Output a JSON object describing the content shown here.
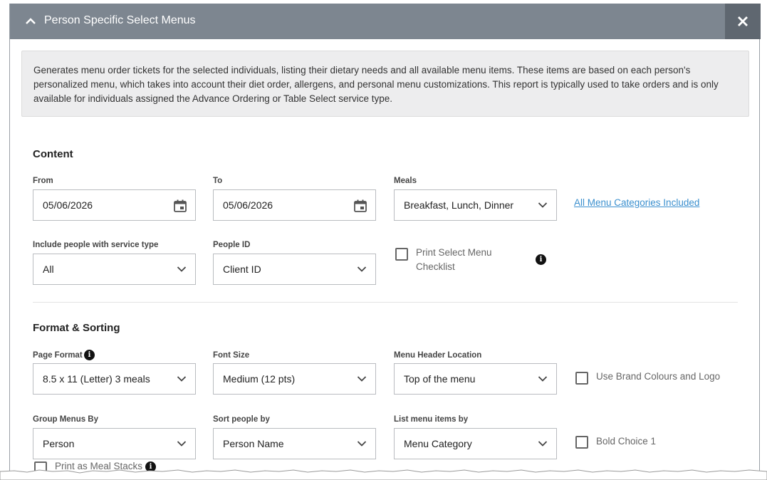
{
  "header": {
    "title": "Person Specific Select Menus",
    "collapse_icon": "chevron-up-icon",
    "close_icon": "close-icon"
  },
  "description": "Generates menu order tickets for the selected individuals, listing their dietary needs and all available menu items. These items are based on each person's personalized menu, which takes into account their diet order, allergens, and personal menu customizations. This report is typically used to take orders and is only available for individuals assigned the Advance Ordering or Table Select service type.",
  "content": {
    "title": "Content",
    "from": {
      "label": "From",
      "value": "05/06/2026"
    },
    "to": {
      "label": "To",
      "value": "05/06/2026"
    },
    "meals": {
      "label": "Meals",
      "value": "Breakfast, Lunch, Dinner"
    },
    "categories_link": "All Menu Categories Included",
    "service_type": {
      "label": "Include people with service type",
      "value": "All"
    },
    "people_id": {
      "label": "People ID",
      "value": "Client ID"
    },
    "print_checklist": {
      "line1": "Print Select Menu",
      "line2": "Checklist",
      "checked": false
    }
  },
  "format": {
    "title": "Format & Sorting",
    "page_format": {
      "label": "Page Format",
      "value": "8.5 x 11 (Letter) 3 meals"
    },
    "font_size": {
      "label": "Font Size",
      "value": "Medium (12 pts)"
    },
    "menu_header": {
      "label": "Menu Header Location",
      "value": "Top of the menu"
    },
    "brand": {
      "label": "Use Brand Colours and Logo",
      "checked": false
    },
    "group_by": {
      "label": "Group Menus By",
      "value": "Person"
    },
    "sort_by": {
      "label": "Sort people by",
      "value": "Person Name"
    },
    "list_by": {
      "label": "List menu items by",
      "value": "Menu Category"
    },
    "bold_choice": {
      "label": "Bold Choice 1",
      "checked": false
    },
    "meal_stacks": {
      "label": "Print as Meal Stacks",
      "checked": false
    }
  },
  "icons": {
    "calendar": "calendar-icon",
    "dropdown": "chevron-down-icon",
    "info": "info-icon"
  },
  "colors": {
    "header_bg": "#7d8690",
    "close_bg": "#5f6770",
    "link": "#3a8fce",
    "desc_bg": "#ededee"
  }
}
